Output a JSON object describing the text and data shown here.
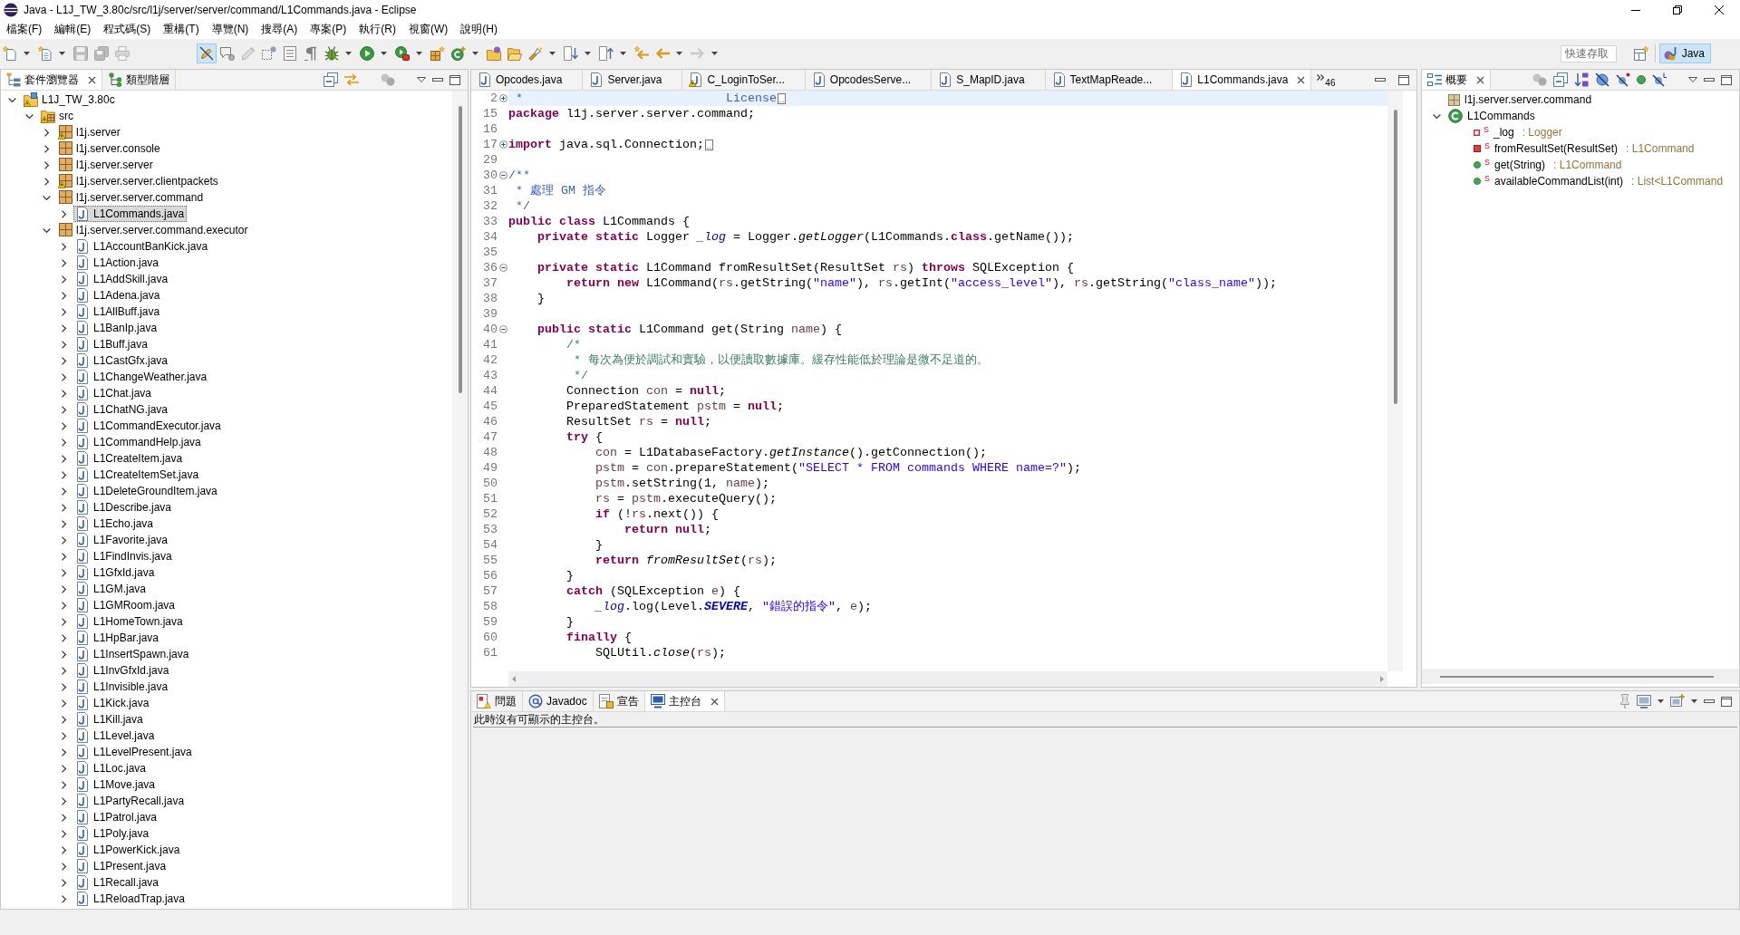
{
  "window": {
    "title": "Java - L1J_TW_3.80c/src/l1j/server/server/command/L1Commands.java - Eclipse"
  },
  "menu": [
    "檔案(F)",
    "編輯(E)",
    "程式碼(S)",
    "重構(T)",
    "導覽(N)",
    "搜尋(A)",
    "專案(P)",
    "執行(R)",
    "視窗(W)",
    "說明(H)"
  ],
  "toolbar": [
    {
      "buttons": [
        {
          "kind": "new",
          "dropdown": true,
          "disabled": false,
          "pressed": false
        },
        {
          "kind": "new-list",
          "dropdown": true,
          "disabled": false,
          "pressed": false
        }
      ]
    },
    {
      "buttons": [
        {
          "kind": "save",
          "dropdown": false,
          "disabled": true,
          "pressed": false
        },
        {
          "kind": "save-all",
          "dropdown": false,
          "disabled": true,
          "pressed": false
        },
        {
          "kind": "print",
          "dropdown": false,
          "disabled": true,
          "pressed": false
        }
      ]
    },
    {
      "buttons": [
        {
          "kind": "mark",
          "dropdown": false,
          "disabled": false,
          "pressed": true
        },
        {
          "kind": "bubble",
          "dropdown": false,
          "disabled": false,
          "pressed": false
        },
        {
          "kind": "pen",
          "dropdown": false,
          "disabled": true,
          "pressed": false
        },
        {
          "kind": "dotted",
          "dropdown": false,
          "disabled": false,
          "pressed": false
        },
        {
          "kind": "text-box",
          "dropdown": false,
          "disabled": false,
          "pressed": false
        },
        {
          "kind": "pilcrow",
          "dropdown": false,
          "disabled": false,
          "pressed": false
        }
      ]
    },
    {
      "buttons": [
        {
          "kind": "bug",
          "dropdown": true,
          "disabled": false,
          "pressed": false
        },
        {
          "kind": "run",
          "dropdown": true,
          "disabled": false,
          "pressed": false
        },
        {
          "kind": "run-tools",
          "dropdown": true,
          "disabled": false,
          "pressed": false
        }
      ]
    },
    {
      "buttons": [
        {
          "kind": "new-project",
          "dropdown": false,
          "disabled": false,
          "pressed": false
        },
        {
          "kind": "new-class",
          "dropdown": true,
          "disabled": false,
          "pressed": false
        }
      ]
    },
    {
      "buttons": [
        {
          "kind": "open-type",
          "dropdown": false,
          "disabled": false,
          "pressed": false
        },
        {
          "kind": "open-folder",
          "dropdown": false,
          "disabled": false,
          "pressed": false
        }
      ]
    },
    {
      "buttons": [
        {
          "kind": "search",
          "dropdown": true,
          "disabled": false,
          "pressed": false
        }
      ]
    },
    {
      "buttons": [
        {
          "kind": "next-annotation",
          "dropdown": true,
          "disabled": false,
          "pressed": false
        },
        {
          "kind": "prev-annotation",
          "dropdown": true,
          "disabled": false,
          "pressed": false
        }
      ]
    },
    {
      "buttons": [
        {
          "kind": "last-edit",
          "dropdown": false,
          "disabled": false,
          "pressed": false
        },
        {
          "kind": "back",
          "dropdown": true,
          "disabled": false,
          "pressed": false
        },
        {
          "kind": "forward",
          "dropdown": true,
          "disabled": true,
          "pressed": false
        }
      ]
    }
  ],
  "quick_access": {
    "placeholder": "快速存取"
  },
  "perspectives": [
    {
      "label": "Java",
      "selected": true
    }
  ],
  "package_explorer": {
    "tabs": [
      {
        "label": "套件瀏覽器",
        "kind": "package-explorer",
        "selected": true
      },
      {
        "label": "類型階層",
        "kind": "type-hierarchy",
        "selected": false
      }
    ],
    "tree": [
      {
        "label": "L1J_TW_3.80c",
        "kind": "project",
        "expanded": true,
        "selected": false,
        "warning": true,
        "children": [
          {
            "label": "src",
            "kind": "source-folder",
            "expanded": true,
            "selected": false,
            "warning": true,
            "children": [
              {
                "label": "l1j.server",
                "kind": "package",
                "expanded": false,
                "selected": false,
                "warning": true
              },
              {
                "label": "l1j.server.console",
                "kind": "package",
                "expanded": false,
                "selected": false,
                "warning": false
              },
              {
                "label": "l1j.server.server",
                "kind": "package",
                "expanded": false,
                "selected": false,
                "warning": false
              },
              {
                "label": "l1j.server.server.clientpackets",
                "kind": "package",
                "expanded": false,
                "selected": false,
                "warning": true
              },
              {
                "label": "l1j.server.server.command",
                "kind": "package",
                "expanded": true,
                "selected": false,
                "warning": false,
                "children": [
                  {
                    "label": "L1Commands.java",
                    "kind": "java-file",
                    "expanded": false,
                    "selected": true,
                    "warning": false
                  }
                ]
              },
              {
                "label": "l1j.server.server.command.executor",
                "kind": "package",
                "expanded": true,
                "selected": false,
                "warning": false,
                "children": [
                  {
                    "label": "L1AccountBanKick.java",
                    "kind": "java-file",
                    "expanded": false,
                    "selected": false,
                    "warning": false
                  },
                  {
                    "label": "L1Action.java",
                    "kind": "java-file",
                    "expanded": false,
                    "selected": false,
                    "warning": false
                  },
                  {
                    "label": "L1AddSkill.java",
                    "kind": "java-file",
                    "expanded": false,
                    "selected": false,
                    "warning": false
                  },
                  {
                    "label": "L1Adena.java",
                    "kind": "java-file",
                    "expanded": false,
                    "selected": false,
                    "warning": false
                  },
                  {
                    "label": "L1AllBuff.java",
                    "kind": "java-file",
                    "expanded": false,
                    "selected": false,
                    "warning": false
                  },
                  {
                    "label": "L1BanIp.java",
                    "kind": "java-file",
                    "expanded": false,
                    "selected": false,
                    "warning": false
                  },
                  {
                    "label": "L1Buff.java",
                    "kind": "java-file",
                    "expanded": false,
                    "selected": false,
                    "warning": false
                  },
                  {
                    "label": "L1CastGfx.java",
                    "kind": "java-file",
                    "expanded": false,
                    "selected": false,
                    "warning": false
                  },
                  {
                    "label": "L1ChangeWeather.java",
                    "kind": "java-file",
                    "expanded": false,
                    "selected": false,
                    "warning": false
                  },
                  {
                    "label": "L1Chat.java",
                    "kind": "java-file",
                    "expanded": false,
                    "selected": false,
                    "warning": false
                  },
                  {
                    "label": "L1ChatNG.java",
                    "kind": "java-file",
                    "expanded": false,
                    "selected": false,
                    "warning": false
                  },
                  {
                    "label": "L1CommandExecutor.java",
                    "kind": "java-file",
                    "expanded": false,
                    "selected": false,
                    "warning": false
                  },
                  {
                    "label": "L1CommandHelp.java",
                    "kind": "java-file",
                    "expanded": false,
                    "selected": false,
                    "warning": false
                  },
                  {
                    "label": "L1CreateItem.java",
                    "kind": "java-file",
                    "expanded": false,
                    "selected": false,
                    "warning": false
                  },
                  {
                    "label": "L1CreateItemSet.java",
                    "kind": "java-file",
                    "expanded": false,
                    "selected": false,
                    "warning": false
                  },
                  {
                    "label": "L1DeleteGroundItem.java",
                    "kind": "java-file",
                    "expanded": false,
                    "selected": false,
                    "warning": false
                  },
                  {
                    "label": "L1Describe.java",
                    "kind": "java-file",
                    "expanded": false,
                    "selected": false,
                    "warning": false
                  },
                  {
                    "label": "L1Echo.java",
                    "kind": "java-file",
                    "expanded": false,
                    "selected": false,
                    "warning": false
                  },
                  {
                    "label": "L1Favorite.java",
                    "kind": "java-file",
                    "expanded": false,
                    "selected": false,
                    "warning": false
                  },
                  {
                    "label": "L1FindInvis.java",
                    "kind": "java-file",
                    "expanded": false,
                    "selected": false,
                    "warning": false
                  },
                  {
                    "label": "L1GfxId.java",
                    "kind": "java-file",
                    "expanded": false,
                    "selected": false,
                    "warning": false
                  },
                  {
                    "label": "L1GM.java",
                    "kind": "java-file",
                    "expanded": false,
                    "selected": false,
                    "warning": false
                  },
                  {
                    "label": "L1GMRoom.java",
                    "kind": "java-file",
                    "expanded": false,
                    "selected": false,
                    "warning": false
                  },
                  {
                    "label": "L1HomeTown.java",
                    "kind": "java-file",
                    "expanded": false,
                    "selected": false,
                    "warning": false
                  },
                  {
                    "label": "L1HpBar.java",
                    "kind": "java-file",
                    "expanded": false,
                    "selected": false,
                    "warning": false
                  },
                  {
                    "label": "L1InsertSpawn.java",
                    "kind": "java-file",
                    "expanded": false,
                    "selected": false,
                    "warning": false
                  },
                  {
                    "label": "L1InvGfxId.java",
                    "kind": "java-file",
                    "expanded": false,
                    "selected": false,
                    "warning": false
                  },
                  {
                    "label": "L1Invisible.java",
                    "kind": "java-file",
                    "expanded": false,
                    "selected": false,
                    "warning": false
                  },
                  {
                    "label": "L1Kick.java",
                    "kind": "java-file",
                    "expanded": false,
                    "selected": false,
                    "warning": false
                  },
                  {
                    "label": "L1Kill.java",
                    "kind": "java-file",
                    "expanded": false,
                    "selected": false,
                    "warning": false
                  },
                  {
                    "label": "L1Level.java",
                    "kind": "java-file",
                    "expanded": false,
                    "selected": false,
                    "warning": false
                  },
                  {
                    "label": "L1LevelPresent.java",
                    "kind": "java-file",
                    "expanded": false,
                    "selected": false,
                    "warning": false
                  },
                  {
                    "label": "L1Loc.java",
                    "kind": "java-file",
                    "expanded": false,
                    "selected": false,
                    "warning": false
                  },
                  {
                    "label": "L1Move.java",
                    "kind": "java-file",
                    "expanded": false,
                    "selected": false,
                    "warning": false
                  },
                  {
                    "label": "L1PartyRecall.java",
                    "kind": "java-file",
                    "expanded": false,
                    "selected": false,
                    "warning": false
                  },
                  {
                    "label": "L1Patrol.java",
                    "kind": "java-file",
                    "expanded": false,
                    "selected": false,
                    "warning": false
                  },
                  {
                    "label": "L1Poly.java",
                    "kind": "java-file",
                    "expanded": false,
                    "selected": false,
                    "warning": false
                  },
                  {
                    "label": "L1PowerKick.java",
                    "kind": "java-file",
                    "expanded": false,
                    "selected": false,
                    "warning": false
                  },
                  {
                    "label": "L1Present.java",
                    "kind": "java-file",
                    "expanded": false,
                    "selected": false,
                    "warning": false
                  },
                  {
                    "label": "L1Recall.java",
                    "kind": "java-file",
                    "expanded": false,
                    "selected": false,
                    "warning": false
                  },
                  {
                    "label": "L1ReloadTrap.java",
                    "kind": "java-file",
                    "expanded": false,
                    "selected": false,
                    "warning": false
                  }
                ]
              }
            ]
          }
        ]
      }
    ]
  },
  "editor": {
    "tabs": [
      {
        "label": "Opcodes.java",
        "selected": false,
        "warning": false
      },
      {
        "label": "Server.java",
        "selected": false,
        "warning": false
      },
      {
        "label": "C_LoginToSer...",
        "selected": false,
        "warning": true
      },
      {
        "label": "OpcodesServe...",
        "selected": false,
        "warning": false
      },
      {
        "label": "S_MapID.java",
        "selected": false,
        "warning": false
      },
      {
        "label": "TextMapReade...",
        "selected": false,
        "warning": false
      },
      {
        "label": "L1Commands.java",
        "selected": true,
        "warning": false
      }
    ],
    "overflow": "46",
    "lines": [
      {
        "number": "2",
        "current": true,
        "collapsed": true,
        "tokens": [
          {
            "kind": "doc",
            "text": " *                            License"
          }
        ]
      },
      {
        "number": "15",
        "current": false,
        "tokens": [
          {
            "kind": "keyword",
            "text": "package"
          },
          {
            "kind": "plain",
            "text": " l1j.server.server.command;"
          }
        ]
      },
      {
        "number": "16",
        "current": false
      },
      {
        "number": "17",
        "current": false,
        "collapsed": true,
        "tokens": [
          {
            "kind": "keyword",
            "text": "import"
          },
          {
            "kind": "plain",
            "text": " java.sql.Connection;"
          }
        ]
      },
      {
        "number": "29",
        "current": false
      },
      {
        "number": "30",
        "current": false,
        "collapsed": false,
        "tokens": [
          {
            "kind": "doc",
            "text": "/**"
          }
        ]
      },
      {
        "number": "31",
        "current": false,
        "tokens": [
          {
            "kind": "doc",
            "text": " * 處理 GM 指令"
          }
        ]
      },
      {
        "number": "32",
        "current": false,
        "tokens": [
          {
            "kind": "doc",
            "text": " */"
          }
        ]
      },
      {
        "number": "33",
        "current": false,
        "tokens": [
          {
            "kind": "keyword",
            "text": "public class"
          },
          {
            "kind": "plain",
            "text": " L1Commands {"
          }
        ]
      },
      {
        "number": "34",
        "current": false,
        "tokens": [
          {
            "kind": "keyword",
            "text": "    private static"
          },
          {
            "kind": "plain",
            "text": " Logger "
          },
          {
            "kind": "static-field",
            "text": "_log"
          },
          {
            "kind": "plain",
            "text": " = Logger."
          },
          {
            "kind": "static-method",
            "text": "getLogger"
          },
          {
            "kind": "plain",
            "text": "(L1Commands."
          },
          {
            "kind": "keyword",
            "text": "class"
          },
          {
            "kind": "plain",
            "text": ".getName());"
          }
        ]
      },
      {
        "number": "35",
        "current": false
      },
      {
        "number": "36",
        "current": false,
        "collapsed": false,
        "tokens": [
          {
            "kind": "keyword",
            "text": "    private static"
          },
          {
            "kind": "plain",
            "text": " L1Command fromResultSet(ResultSet "
          },
          {
            "kind": "local",
            "text": "rs"
          },
          {
            "kind": "plain",
            "text": ") "
          },
          {
            "kind": "keyword",
            "text": "throws"
          },
          {
            "kind": "plain",
            "text": " SQLException {"
          }
        ]
      },
      {
        "number": "37",
        "current": false,
        "tokens": [
          {
            "kind": "keyword",
            "text": "        return new"
          },
          {
            "kind": "plain",
            "text": " L1Command("
          },
          {
            "kind": "local",
            "text": "rs"
          },
          {
            "kind": "plain",
            "text": ".getString("
          },
          {
            "kind": "string",
            "text": "\"name\""
          },
          {
            "kind": "plain",
            "text": "), "
          },
          {
            "kind": "local",
            "text": "rs"
          },
          {
            "kind": "plain",
            "text": ".getInt("
          },
          {
            "kind": "string",
            "text": "\"access_level\""
          },
          {
            "kind": "plain",
            "text": "), "
          },
          {
            "kind": "local",
            "text": "rs"
          },
          {
            "kind": "plain",
            "text": ".getString("
          },
          {
            "kind": "string",
            "text": "\"class_name\""
          },
          {
            "kind": "plain",
            "text": "));"
          }
        ]
      },
      {
        "number": "38",
        "current": false,
        "tokens": [
          {
            "kind": "plain",
            "text": "    }"
          }
        ]
      },
      {
        "number": "39",
        "current": false
      },
      {
        "number": "40",
        "current": false,
        "collapsed": false,
        "tokens": [
          {
            "kind": "keyword",
            "text": "    public static"
          },
          {
            "kind": "plain",
            "text": " L1Command get(String "
          },
          {
            "kind": "local",
            "text": "name"
          },
          {
            "kind": "plain",
            "text": ") {"
          }
        ]
      },
      {
        "number": "41",
        "current": false,
        "tokens": [
          {
            "kind": "comment",
            "text": "        /*"
          }
        ]
      },
      {
        "number": "42",
        "current": false,
        "tokens": [
          {
            "kind": "comment",
            "text": "         * 每次為便於調試和實驗，以便讀取數據庫。緩存性能低於理論是微不足道的。"
          }
        ]
      },
      {
        "number": "43",
        "current": false,
        "tokens": [
          {
            "kind": "comment",
            "text": "         */"
          }
        ]
      },
      {
        "number": "44",
        "current": false,
        "tokens": [
          {
            "kind": "plain",
            "text": "        Connection "
          },
          {
            "kind": "local",
            "text": "con"
          },
          {
            "kind": "plain",
            "text": " = "
          },
          {
            "kind": "keyword",
            "text": "null"
          },
          {
            "kind": "plain",
            "text": ";"
          }
        ]
      },
      {
        "number": "45",
        "current": false,
        "tokens": [
          {
            "kind": "plain",
            "text": "        PreparedStatement "
          },
          {
            "kind": "local",
            "text": "pstm"
          },
          {
            "kind": "plain",
            "text": " = "
          },
          {
            "kind": "keyword",
            "text": "null"
          },
          {
            "kind": "plain",
            "text": ";"
          }
        ]
      },
      {
        "number": "46",
        "current": false,
        "tokens": [
          {
            "kind": "plain",
            "text": "        ResultSet "
          },
          {
            "kind": "local",
            "text": "rs"
          },
          {
            "kind": "plain",
            "text": " = "
          },
          {
            "kind": "keyword",
            "text": "null"
          },
          {
            "kind": "plain",
            "text": ";"
          }
        ]
      },
      {
        "number": "47",
        "current": false,
        "tokens": [
          {
            "kind": "keyword",
            "text": "        try"
          },
          {
            "kind": "plain",
            "text": " {"
          }
        ]
      },
      {
        "number": "48",
        "current": false,
        "tokens": [
          {
            "kind": "local",
            "text": "            con"
          },
          {
            "kind": "plain",
            "text": " = L1DatabaseFactory."
          },
          {
            "kind": "static-method",
            "text": "getInstance"
          },
          {
            "kind": "plain",
            "text": "().getConnection();"
          }
        ]
      },
      {
        "number": "49",
        "current": false,
        "tokens": [
          {
            "kind": "local",
            "text": "            pstm"
          },
          {
            "kind": "plain",
            "text": " = "
          },
          {
            "kind": "local",
            "text": "con"
          },
          {
            "kind": "plain",
            "text": ".prepareStatement("
          },
          {
            "kind": "string",
            "text": "\"SELECT * FROM commands WHERE name=?\""
          },
          {
            "kind": "plain",
            "text": ");"
          }
        ]
      },
      {
        "number": "50",
        "current": false,
        "tokens": [
          {
            "kind": "local",
            "text": "            pstm"
          },
          {
            "kind": "plain",
            "text": ".setString(1, "
          },
          {
            "kind": "local",
            "text": "name"
          },
          {
            "kind": "plain",
            "text": ");"
          }
        ]
      },
      {
        "number": "51",
        "current": false,
        "tokens": [
          {
            "kind": "local",
            "text": "            rs"
          },
          {
            "kind": "plain",
            "text": " = "
          },
          {
            "kind": "local",
            "text": "pstm"
          },
          {
            "kind": "plain",
            "text": ".executeQuery();"
          }
        ]
      },
      {
        "number": "52",
        "current": false,
        "tokens": [
          {
            "kind": "keyword",
            "text": "            if"
          },
          {
            "kind": "plain",
            "text": " (!"
          },
          {
            "kind": "local",
            "text": "rs"
          },
          {
            "kind": "plain",
            "text": ".next()) {"
          }
        ]
      },
      {
        "number": "53",
        "current": false,
        "tokens": [
          {
            "kind": "keyword",
            "text": "                return null"
          },
          {
            "kind": "plain",
            "text": ";"
          }
        ]
      },
      {
        "number": "54",
        "current": false,
        "tokens": [
          {
            "kind": "plain",
            "text": "            }"
          }
        ]
      },
      {
        "number": "55",
        "current": false,
        "tokens": [
          {
            "kind": "keyword",
            "text": "            return "
          },
          {
            "kind": "static-method",
            "text": "fromResultSet"
          },
          {
            "kind": "plain",
            "text": "("
          },
          {
            "kind": "local",
            "text": "rs"
          },
          {
            "kind": "plain",
            "text": ");"
          }
        ]
      },
      {
        "number": "56",
        "current": false,
        "tokens": [
          {
            "kind": "plain",
            "text": "        }"
          }
        ]
      },
      {
        "number": "57",
        "current": false,
        "tokens": [
          {
            "kind": "keyword",
            "text": "        catch"
          },
          {
            "kind": "plain",
            "text": " (SQLException "
          },
          {
            "kind": "local",
            "text": "e"
          },
          {
            "kind": "plain",
            "text": ") {"
          }
        ]
      },
      {
        "number": "58",
        "current": false,
        "tokens": [
          {
            "kind": "static-field",
            "text": "            _log"
          },
          {
            "kind": "plain",
            "text": ".log(Level."
          },
          {
            "kind": "constant",
            "text": "SEVERE"
          },
          {
            "kind": "plain",
            "text": ", "
          },
          {
            "kind": "string",
            "text": "\"錯誤的指令\""
          },
          {
            "kind": "plain",
            "text": ", "
          },
          {
            "kind": "local",
            "text": "e"
          },
          {
            "kind": "plain",
            "text": ");"
          }
        ]
      },
      {
        "number": "59",
        "current": false,
        "tokens": [
          {
            "kind": "plain",
            "text": "        }"
          }
        ]
      },
      {
        "number": "60",
        "current": false,
        "tokens": [
          {
            "kind": "keyword",
            "text": "        finally"
          },
          {
            "kind": "plain",
            "text": " {"
          }
        ]
      },
      {
        "number": "61",
        "current": false,
        "tokens": [
          {
            "kind": "plain",
            "text": "            SQLUtil."
          },
          {
            "kind": "static-method",
            "text": "close"
          },
          {
            "kind": "plain",
            "text": "("
          },
          {
            "kind": "local",
            "text": "rs"
          },
          {
            "kind": "plain",
            "text": ");"
          }
        ]
      }
    ]
  },
  "outline": {
    "tabs": [
      {
        "label": "概要",
        "kind": "outline",
        "selected": true
      }
    ],
    "tree": [
      {
        "label": "l1j.server.server.command",
        "kind": "package-declaration",
        "selected": false
      },
      {
        "label": "L1Commands",
        "kind": "class",
        "expanded": true,
        "selected": false,
        "children": [
          {
            "label": "_log",
            "kind": "private-field",
            "overlay": "S",
            "type": ": Logger",
            "selected": false
          },
          {
            "label": "fromResultSet(ResultSet)",
            "kind": "private-method",
            "overlay": "S",
            "type": ": L1Command",
            "selected": false
          },
          {
            "label": "get(String)",
            "kind": "public-method",
            "overlay": "S",
            "type": ": L1Command",
            "selected": false
          },
          {
            "label": "availableCommandList(int)",
            "kind": "public-method",
            "overlay": "S",
            "type": ": List<L1Command",
            "selected": false
          }
        ]
      }
    ]
  },
  "console": {
    "tabs": [
      {
        "label": "問題",
        "kind": "problems",
        "selected": false
      },
      {
        "label": "Javadoc",
        "kind": "javadoc",
        "selected": false
      },
      {
        "label": "宣告",
        "kind": "declaration",
        "selected": false
      },
      {
        "label": "主控台",
        "kind": "console",
        "selected": true
      }
    ],
    "message": "此時沒有可顯示的主控台。"
  }
}
